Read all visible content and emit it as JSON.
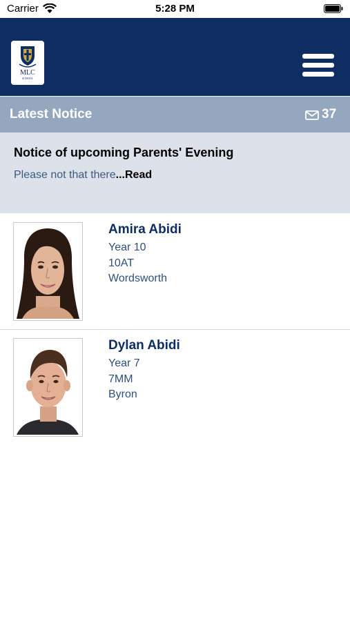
{
  "status_bar": {
    "carrier": "Carrier",
    "time": "5:28 PM"
  },
  "header": {
    "logo_text": "MLC",
    "logo_subtext": "SCHOOL"
  },
  "notice_bar": {
    "title": "Latest Notice",
    "count": "37"
  },
  "notice": {
    "title": "Notice of upcoming Parents' Evening",
    "snippet": "Please not that there",
    "read_label": "...Read"
  },
  "students": [
    {
      "name": "Amira Abidi",
      "year": "Year 10",
      "form": "10AT",
      "house": "Wordsworth"
    },
    {
      "name": "Dylan Abidi",
      "year": "Year 7",
      "form": "7MM",
      "house": "Byron"
    }
  ],
  "colors": {
    "header_bg": "#0d2d63",
    "notice_bar_bg": "#95a7bf",
    "notice_body_bg": "#dde2ea",
    "name_color": "#0d2d63",
    "detail_color": "#2e4f7c"
  }
}
